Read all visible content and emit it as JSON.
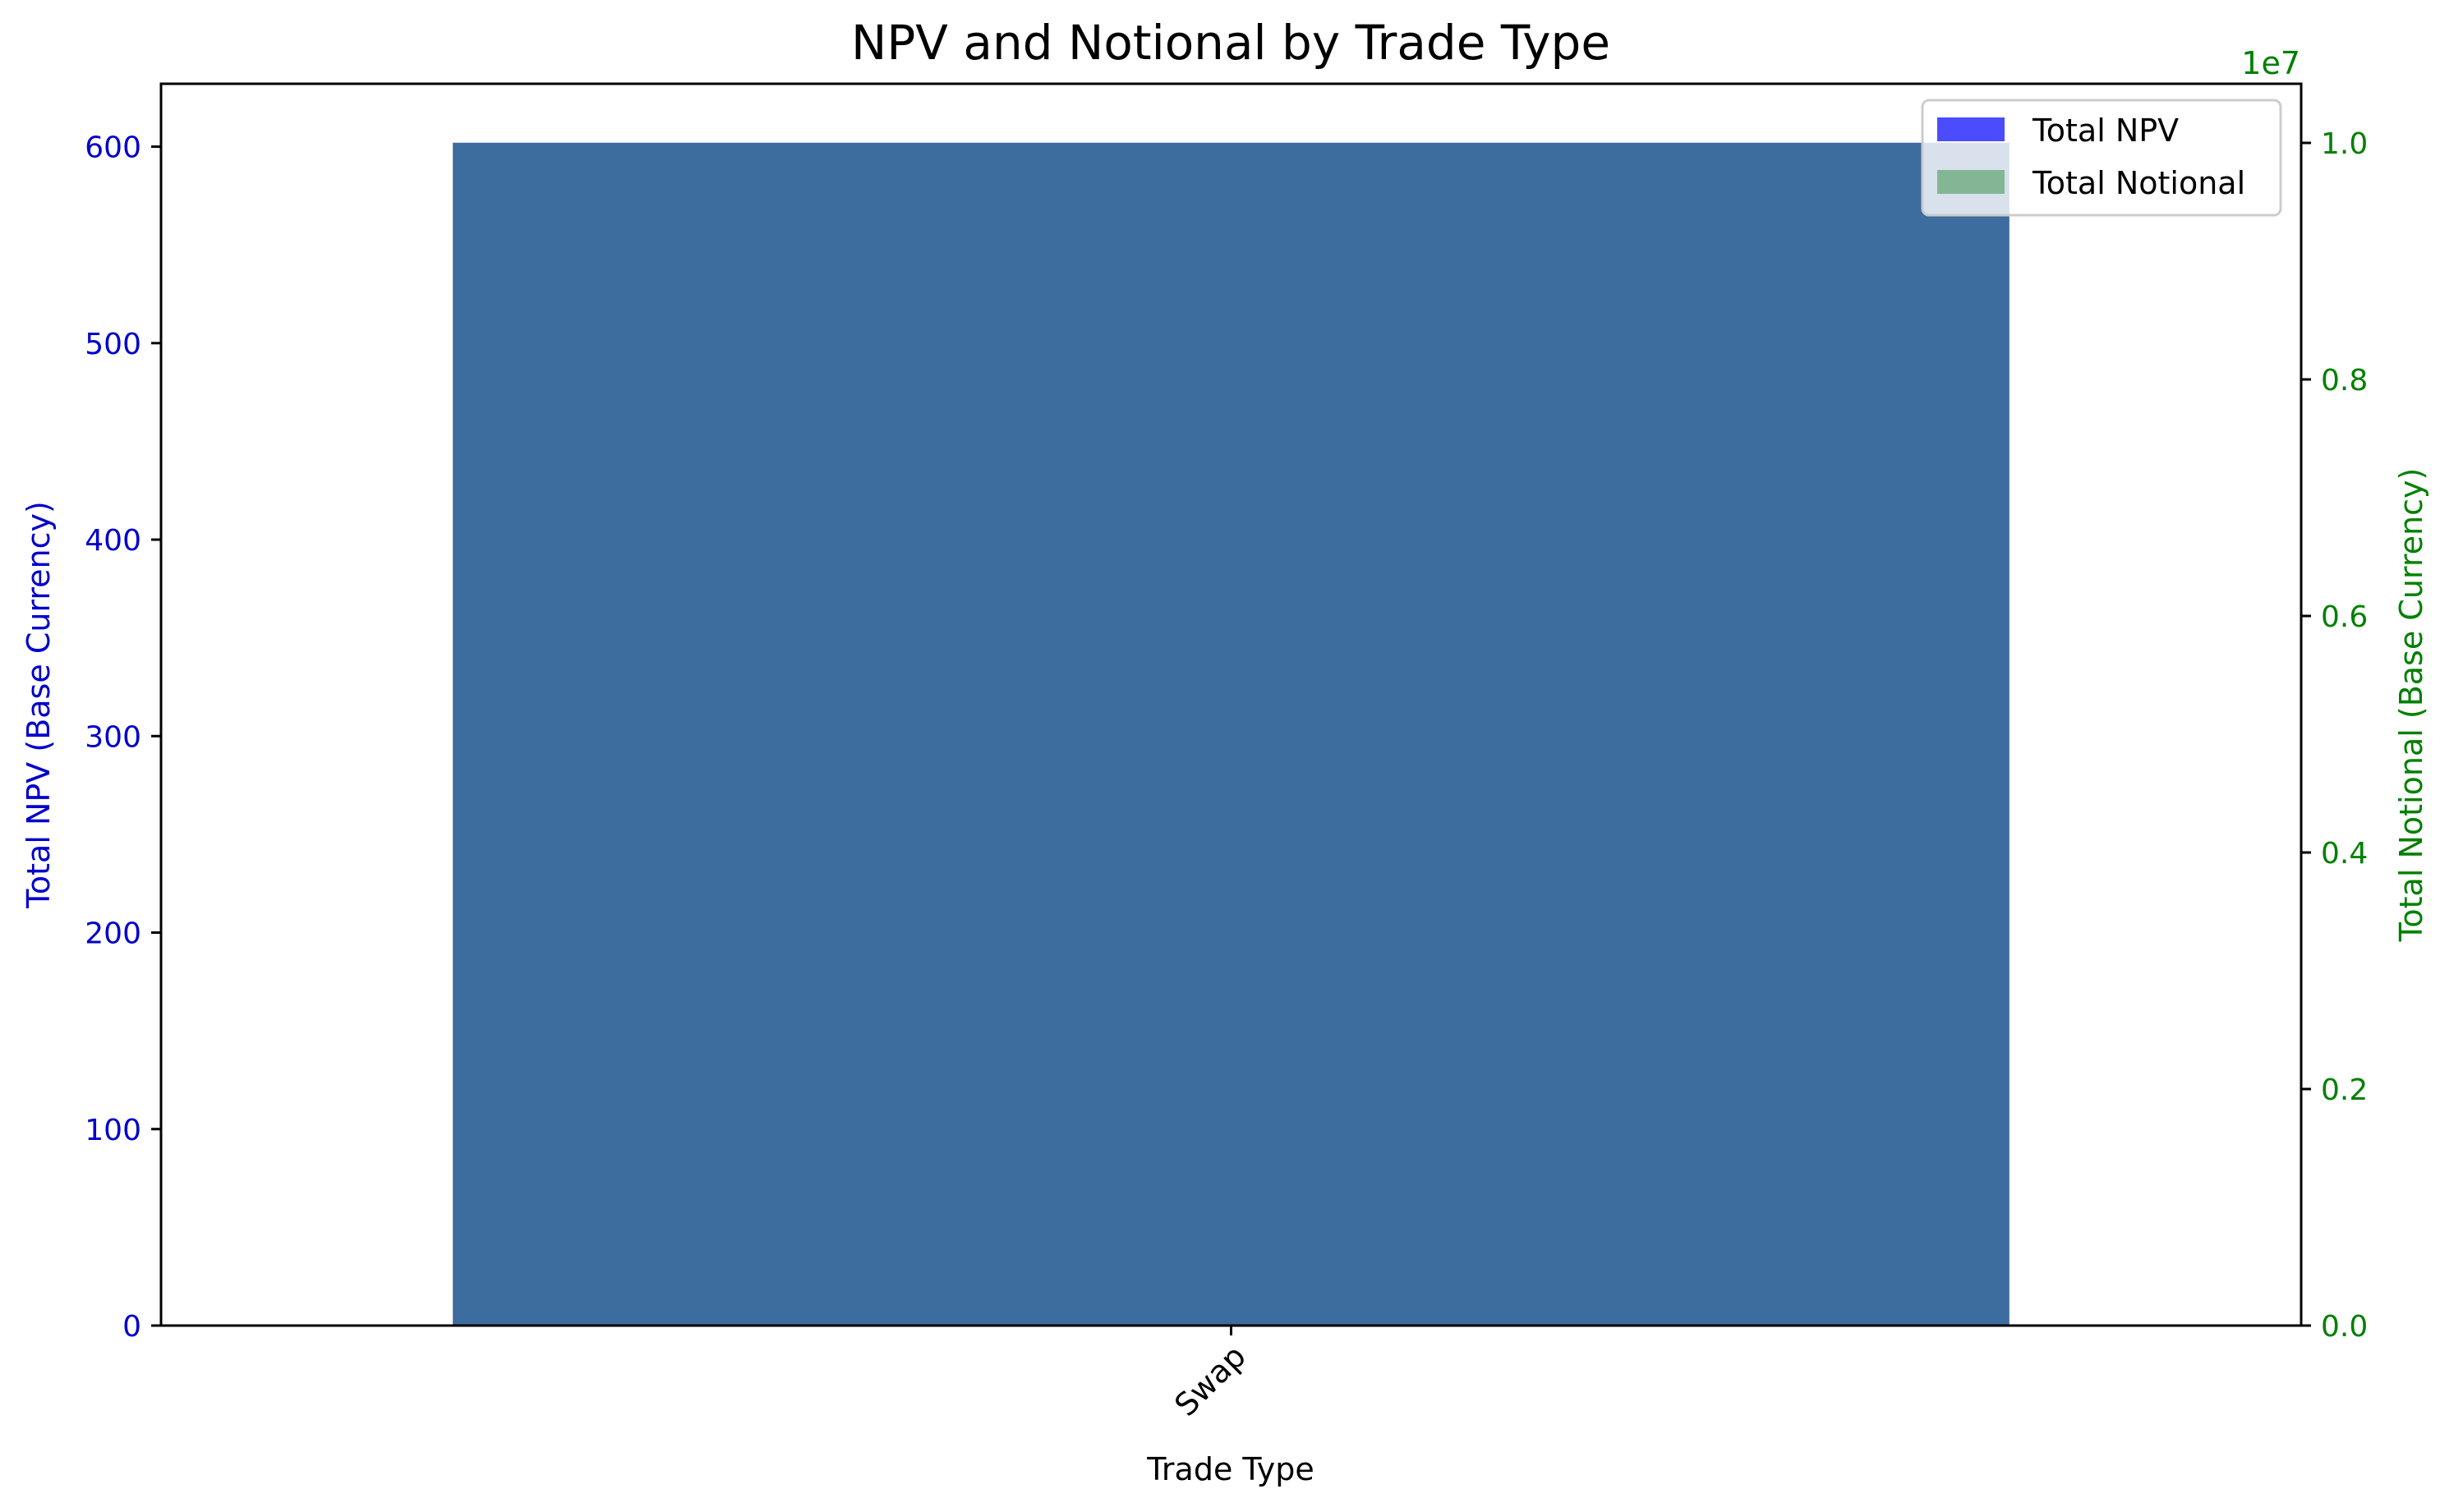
{
  "chart_data": {
    "type": "bar",
    "title": "NPV and Notional by Trade Type",
    "xlabel": "Trade Type",
    "categories": [
      "Swap"
    ],
    "series": [
      {
        "name": "Total NPV",
        "axis": "left",
        "values": [
          602
        ],
        "color": "#0000ff",
        "opacity": 0.7
      },
      {
        "name": "Total Notional",
        "axis": "right",
        "values": [
          10000000
        ],
        "color": "#2e8b3e",
        "opacity": 0.5
      }
    ],
    "y_left": {
      "label": "Total NPV (Base Currency)",
      "color": "#0000cc",
      "range": [
        0,
        632
      ],
      "ticks": [
        0,
        100,
        200,
        300,
        400,
        500,
        600
      ],
      "tick_labels": [
        "0",
        "100",
        "200",
        "300",
        "400",
        "500",
        "600"
      ]
    },
    "y_right": {
      "label": "Total Notional (Base Currency)",
      "color": "#008000",
      "offset_label": "1e7",
      "range": [
        0,
        10500000
      ],
      "ticks": [
        0,
        2000000,
        4000000,
        6000000,
        8000000,
        10000000
      ],
      "tick_labels": [
        "0.0",
        "0.2",
        "0.4",
        "0.6",
        "0.8",
        "1.0"
      ]
    },
    "overlap_color": "#2e6096",
    "grid": false,
    "legend_position": "top-right"
  }
}
